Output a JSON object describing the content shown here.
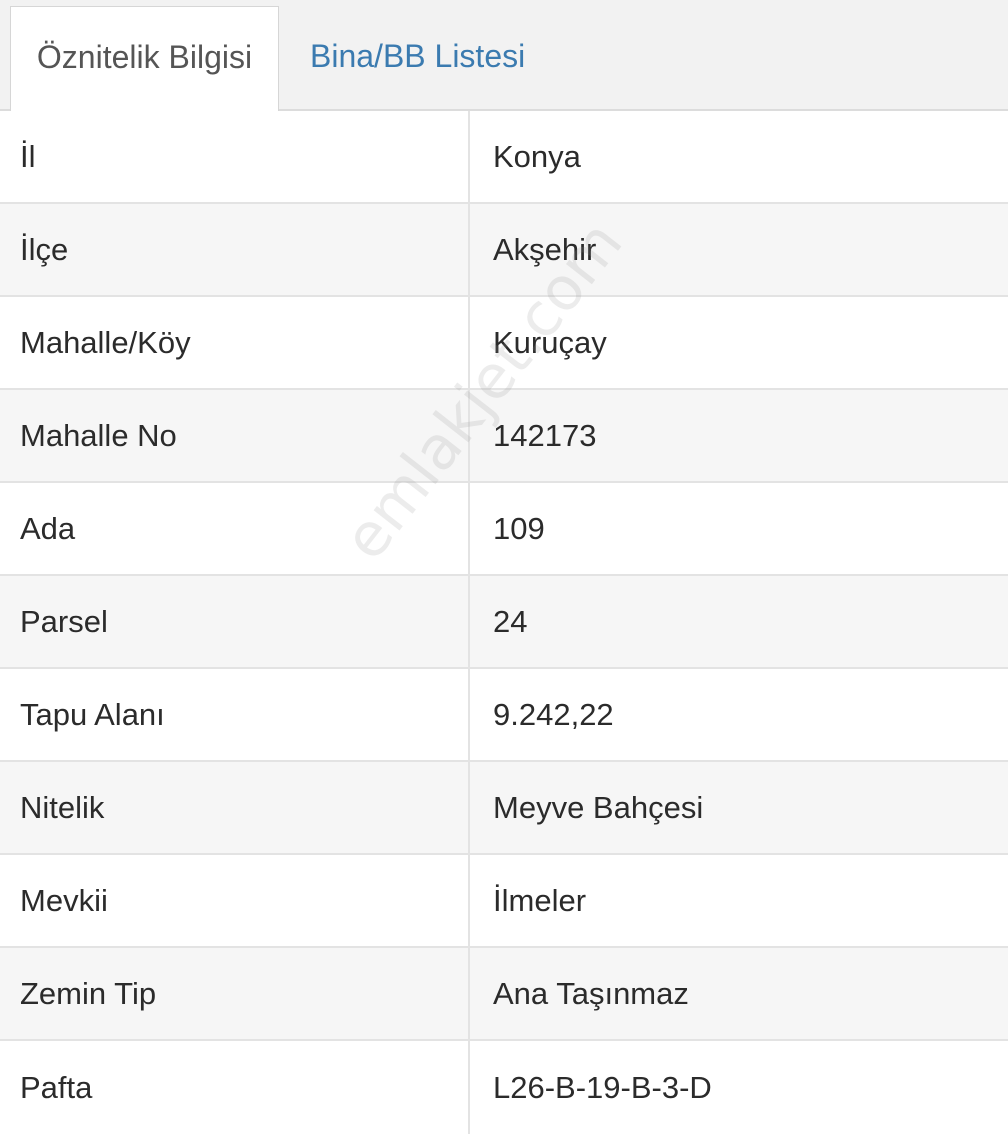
{
  "tabs": [
    {
      "label": "Öznitelik Bilgisi",
      "active": true
    },
    {
      "label": "Bina/BB Listesi",
      "active": false
    }
  ],
  "rows": [
    {
      "label": "İl",
      "value": "Konya"
    },
    {
      "label": "İlçe",
      "value": "Akşehir"
    },
    {
      "label": "Mahalle/Köy",
      "value": "Kuruçay"
    },
    {
      "label": "Mahalle No",
      "value": "142173"
    },
    {
      "label": "Ada",
      "value": "109"
    },
    {
      "label": "Parsel",
      "value": "24"
    },
    {
      "label": "Tapu Alanı",
      "value": "9.242,22"
    },
    {
      "label": "Nitelik",
      "value": "Meyve Bahçesi"
    },
    {
      "label": "Mevkii",
      "value": "İlmeler"
    },
    {
      "label": "Zemin Tip",
      "value": "Ana Taşınmaz"
    },
    {
      "label": "Pafta",
      "value": "L26-B-19-B-3-D"
    }
  ],
  "watermark": "emlakjet.com",
  "colors": {
    "tab_link": "#3b7bb0",
    "tab_active_text": "#555555",
    "text": "#2b2b2b",
    "tabbar_bg": "#f2f2f2",
    "row_alt_bg": "#f6f6f6",
    "border": "#e3e3e3"
  }
}
